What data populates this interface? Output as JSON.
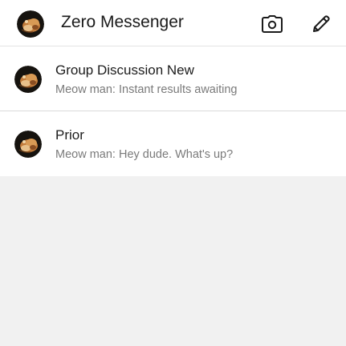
{
  "header": {
    "title": "Zero Messenger",
    "avatar_icon": "user-avatar-icon",
    "camera_icon": "camera-icon",
    "compose_icon": "pencil-icon"
  },
  "conversations": [
    {
      "title": "Group Discussion New",
      "preview": "Meow man: Instant results awaiting",
      "avatar_icon": "conversation-avatar-icon"
    },
    {
      "title": "Prior",
      "preview": "Meow man: Hey dude. What's up?",
      "avatar_icon": "conversation-avatar-icon"
    }
  ],
  "colors": {
    "background": "#f1f1f1",
    "surface": "#ffffff",
    "title_text": "#1a1a1a",
    "secondary_text": "#7a7a7a"
  }
}
